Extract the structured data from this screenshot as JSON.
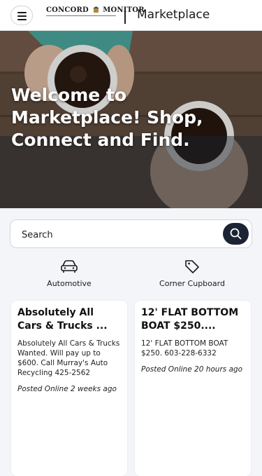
{
  "header": {
    "menu_icon": "hamburger-icon",
    "logo_left": "CONCORD",
    "logo_right": "MONITOR",
    "section_title": "Marketplace"
  },
  "hero": {
    "title": "Welcome to Marketplace! Shop, Connect and Find."
  },
  "search": {
    "placeholder": "Search",
    "button_icon": "search-icon"
  },
  "categories": [
    {
      "label": "Automotive",
      "icon": "car-icon"
    },
    {
      "label": "Corner Cupboard",
      "icon": "tag-icon"
    }
  ],
  "listings": [
    {
      "title": "Absolutely All Cars & Trucks ...",
      "description": "Absolutely All Cars & Trucks Wanted. Will pay up to $600. Call Murray's Auto Recycling 425-2562",
      "posted": "Posted Online 2 weeks ago"
    },
    {
      "title": "12' FLAT BOTTOM BOAT $250....",
      "description": "12' FLAT BOTTOM BOAT $250. 603-228-6332",
      "posted": "Posted Online 20 hours ago"
    }
  ],
  "colors": {
    "accent_dark": "#1c2434",
    "background": "#f3f5f8"
  }
}
